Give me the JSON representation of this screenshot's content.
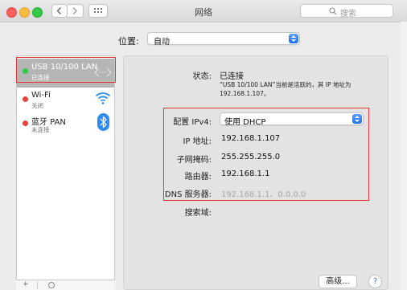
{
  "window": {
    "title": "网络"
  },
  "search": {
    "placeholder": "搜索"
  },
  "location": {
    "label": "位置:",
    "value": "自动"
  },
  "services": [
    {
      "name": "USB 10/100 LAN",
      "status": "已连接",
      "state_color": "#33c748",
      "icon": "ethernet-arrows-icon"
    },
    {
      "name": "Wi-Fi",
      "status": "关闭",
      "state_color": "#e8423c",
      "icon": "wifi-icon"
    },
    {
      "name": "蓝牙 PAN",
      "status": "未连接",
      "state_color": "#e8423c",
      "icon": "bluetooth-icon"
    }
  ],
  "detail": {
    "status_label": "状态:",
    "status_value": "已连接",
    "status_description_line1": "“USB 10/100 LAN”当前是活跃的，其 IP 地址为",
    "status_description_line2": "192.168.1.107。",
    "configure_label": "配置 IPv4:",
    "configure_value": "使用 DHCP",
    "ip_label": "IP 地址:",
    "ip_value": "192.168.1.107",
    "subnet_label": "子网掩码:",
    "subnet_value": "255.255.255.0",
    "router_label": "路由器:",
    "router_value": "192.168.1.1",
    "dns_label": "DNS 服务器:",
    "dns_value": "192.168.1.1、0.0.0.0",
    "search_domains_label": "搜索域:"
  },
  "buttons": {
    "advanced": "高级...",
    "help": "?"
  },
  "colors": {
    "highlight_box": "#e23a3a",
    "accent": "#1e6ff2",
    "selected_row": "#b5b5b5"
  }
}
